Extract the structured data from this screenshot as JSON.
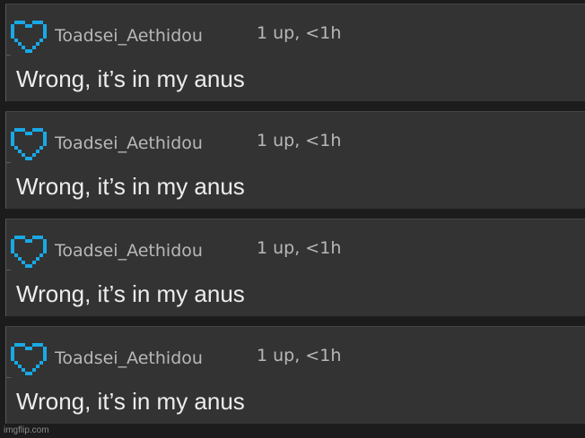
{
  "colors": {
    "background": "#1c1c1c",
    "card": "#333333",
    "heart": "#19a9e6",
    "username": "#b8b8b8",
    "body": "#ededed"
  },
  "comments": [
    {
      "username": "Toadsei_Aethidou",
      "meta": "1 up, <1h",
      "text": "Wrong, it’s in my anus",
      "icon": "pixel-heart-icon"
    },
    {
      "username": "Toadsei_Aethidou",
      "meta": "1 up, <1h",
      "text": "Wrong, it’s in my anus",
      "icon": "pixel-heart-icon"
    },
    {
      "username": "Toadsei_Aethidou",
      "meta": "1 up, <1h",
      "text": "Wrong, it’s in my anus",
      "icon": "pixel-heart-icon"
    },
    {
      "username": "Toadsei_Aethidou",
      "meta": "1 up, <1h",
      "text": "Wrong, it’s in my anus",
      "icon": "pixel-heart-icon"
    }
  ],
  "watermark": "imgflip.com"
}
